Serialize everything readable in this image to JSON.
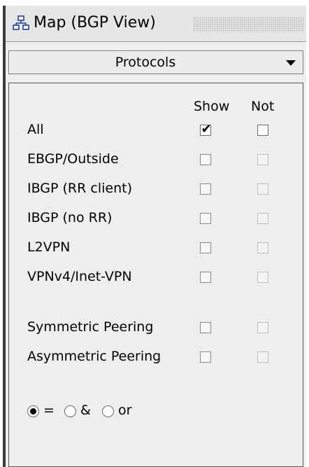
{
  "window": {
    "title": "Map (BGP View)",
    "icon": "network-map-icon"
  },
  "dropdown": {
    "selected": "Protocols"
  },
  "columns": {
    "show": "Show",
    "not": "Not"
  },
  "rows": [
    {
      "label": "All",
      "show_checked": true,
      "not_enabled": true
    },
    {
      "label": "EBGP/Outside",
      "show_checked": false,
      "not_enabled": false
    },
    {
      "label": "IBGP (RR client)",
      "show_checked": false,
      "not_enabled": false
    },
    {
      "label": "IBGP (no RR)",
      "show_checked": false,
      "not_enabled": false
    },
    {
      "label": "L2VPN",
      "show_checked": false,
      "not_enabled": false
    },
    {
      "label": "VPNv4/Inet-VPN",
      "show_checked": false,
      "not_enabled": false
    },
    {
      "label": "Symmetric Peering",
      "show_checked": false,
      "not_enabled": false
    },
    {
      "label": "Asymmetric Peering",
      "show_checked": false,
      "not_enabled": false
    }
  ],
  "operators": [
    {
      "label": "=",
      "selected": true
    },
    {
      "label": "&",
      "selected": false
    },
    {
      "label": "or",
      "selected": false
    }
  ]
}
